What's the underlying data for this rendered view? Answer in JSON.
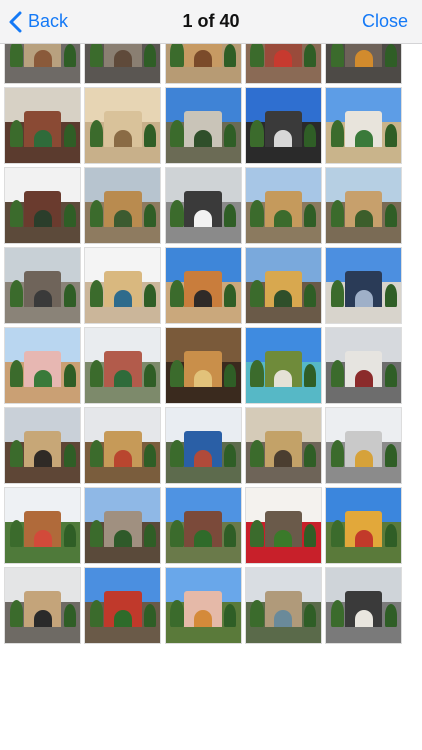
{
  "nav": {
    "back_label": "Back",
    "title": "1 of 40",
    "close_label": "Close",
    "accent_color": "#1479f6"
  },
  "thumbnails": [
    {
      "sky": "#c9cdd3",
      "ground": "#6e6a66",
      "bldg": "#b8a17f",
      "accent": "#8a5a3a"
    },
    {
      "sky": "#b9bcbf",
      "ground": "#5a5652",
      "bldg": "#8a7f72",
      "accent": "#5f4a3a"
    },
    {
      "sky": "#f1f2f4",
      "ground": "#b79b74",
      "bldg": "#c79a63",
      "accent": "#7b4b2a"
    },
    {
      "sky": "#e8e4e0",
      "ground": "#8a6a55",
      "bldg": "#9a4b3b",
      "accent": "#c73a2f"
    },
    {
      "sky": "#9aa0a6",
      "ground": "#4d4a46",
      "bldg": "#6e6259",
      "accent": "#d28b2d"
    },
    {
      "sky": "#d7d1c5",
      "ground": "#5b3b2e",
      "bldg": "#8a4a34",
      "accent": "#2f6b3a"
    },
    {
      "sky": "#e7d5b4",
      "ground": "#c8b08a",
      "bldg": "#d9c29a",
      "accent": "#8a6b45"
    },
    {
      "sky": "#3f83d6",
      "ground": "#6b6b55",
      "bldg": "#c9c4b8",
      "accent": "#2f4f2a"
    },
    {
      "sky": "#2f6fd0",
      "ground": "#2a2a2a",
      "bldg": "#3a3a3a",
      "accent": "#d7d7d7"
    },
    {
      "sky": "#5d9de6",
      "ground": "#c9b48b",
      "bldg": "#e8e4dc",
      "accent": "#3a7a3a"
    },
    {
      "sky": "#f2f2f2",
      "ground": "#5c4a3a",
      "bldg": "#6a3b2e",
      "accent": "#2b3e2b"
    },
    {
      "sky": "#b7c4cf",
      "ground": "#8e7b60",
      "bldg": "#b98b4f",
      "accent": "#3c5b30"
    },
    {
      "sky": "#cfd3d6",
      "ground": "#8a8a8a",
      "bldg": "#3a3a3a",
      "accent": "#f2f2f2"
    },
    {
      "sky": "#a7c6e6",
      "ground": "#8b7a5f",
      "bldg": "#c59a5c",
      "accent": "#3b6b2c"
    },
    {
      "sky": "#b6cfe3",
      "ground": "#7a6b55",
      "bldg": "#c7a06c",
      "accent": "#3c5e2b"
    },
    {
      "sky": "#c8d0d6",
      "ground": "#8a8378",
      "bldg": "#6f645a",
      "accent": "#3a3a3a"
    },
    {
      "sky": "#f4f4f4",
      "ground": "#cbb69a",
      "bldg": "#d9b87f",
      "accent": "#2e6b8c"
    },
    {
      "sky": "#3e86d9",
      "ground": "#caa87c",
      "bldg": "#c97d3c",
      "accent": "#2f2a28"
    },
    {
      "sky": "#7aa9dc",
      "ground": "#6a5a48",
      "bldg": "#d8a84f",
      "accent": "#2f4f2a"
    },
    {
      "sky": "#4c8fe0",
      "ground": "#d8d4cc",
      "bldg": "#2a3b57",
      "accent": "#9fb0c8"
    },
    {
      "sky": "#b9d6f0",
      "ground": "#caa074",
      "bldg": "#e7b7b2",
      "accent": "#3a7a3a"
    },
    {
      "sky": "#e9ecef",
      "ground": "#7d8a6b",
      "bldg": "#b25b4b",
      "accent": "#2f6b3a"
    },
    {
      "sky": "#7a5a3a",
      "ground": "#3a2a1e",
      "bldg": "#c98f4a",
      "accent": "#e2c27a"
    },
    {
      "sky": "#3f8be0",
      "ground": "#56b8c6",
      "bldg": "#6f8b3a",
      "accent": "#e5e1d6"
    },
    {
      "sky": "#d6d9dd",
      "ground": "#6d6d6d",
      "bldg": "#e6e4e0",
      "accent": "#8b2b2b"
    },
    {
      "sky": "#c9d0d8",
      "ground": "#5e4636",
      "bldg": "#c7a777",
      "accent": "#2f2a26"
    },
    {
      "sky": "#e5e7ea",
      "ground": "#7a5d3d",
      "bldg": "#c69a58",
      "accent": "#b9462f"
    },
    {
      "sky": "#e9edf2",
      "ground": "#5d6b4d",
      "bldg": "#2a5fa6",
      "accent": "#b04a3a"
    },
    {
      "sky": "#d5cbb8",
      "ground": "#6e6458",
      "bldg": "#c3a268",
      "accent": "#4b3e30"
    },
    {
      "sky": "#eceef1",
      "ground": "#8b8b8b",
      "bldg": "#c9c9c9",
      "accent": "#d6a23a"
    },
    {
      "sky": "#eef1f4",
      "ground": "#4f7a3a",
      "bldg": "#b06a3a",
      "accent": "#d24a3a"
    },
    {
      "sky": "#8fb8e6",
      "ground": "#5a4a3a",
      "bldg": "#a09080",
      "accent": "#2f5a2a"
    },
    {
      "sky": "#4f93e2",
      "ground": "#6a7a4a",
      "bldg": "#7b4a3a",
      "accent": "#2f6b2a"
    },
    {
      "sky": "#f4f2ee",
      "ground": "#c8202a",
      "bldg": "#6a5a4a",
      "accent": "#3a7a2a"
    },
    {
      "sky": "#3b86dd",
      "ground": "#5a7a3a",
      "bldg": "#e2a83a",
      "accent": "#c23a2a"
    },
    {
      "sky": "#e4e5e6",
      "ground": "#6e6a64",
      "bldg": "#c4a47a",
      "accent": "#2a2a2a"
    },
    {
      "sky": "#4b8fe0",
      "ground": "#6a5a48",
      "bldg": "#c0392b",
      "accent": "#2e6b2a"
    },
    {
      "sky": "#69a7ea",
      "ground": "#5a7a3a",
      "bldg": "#e5b9a8",
      "accent": "#d48a3a"
    },
    {
      "sky": "#d9dde2",
      "ground": "#5a6a4a",
      "bldg": "#b09a7a",
      "accent": "#6a8a9a"
    },
    {
      "sky": "#cfd4d9",
      "ground": "#7a7a7a",
      "bldg": "#3a3a3a",
      "accent": "#e9e6df"
    }
  ]
}
